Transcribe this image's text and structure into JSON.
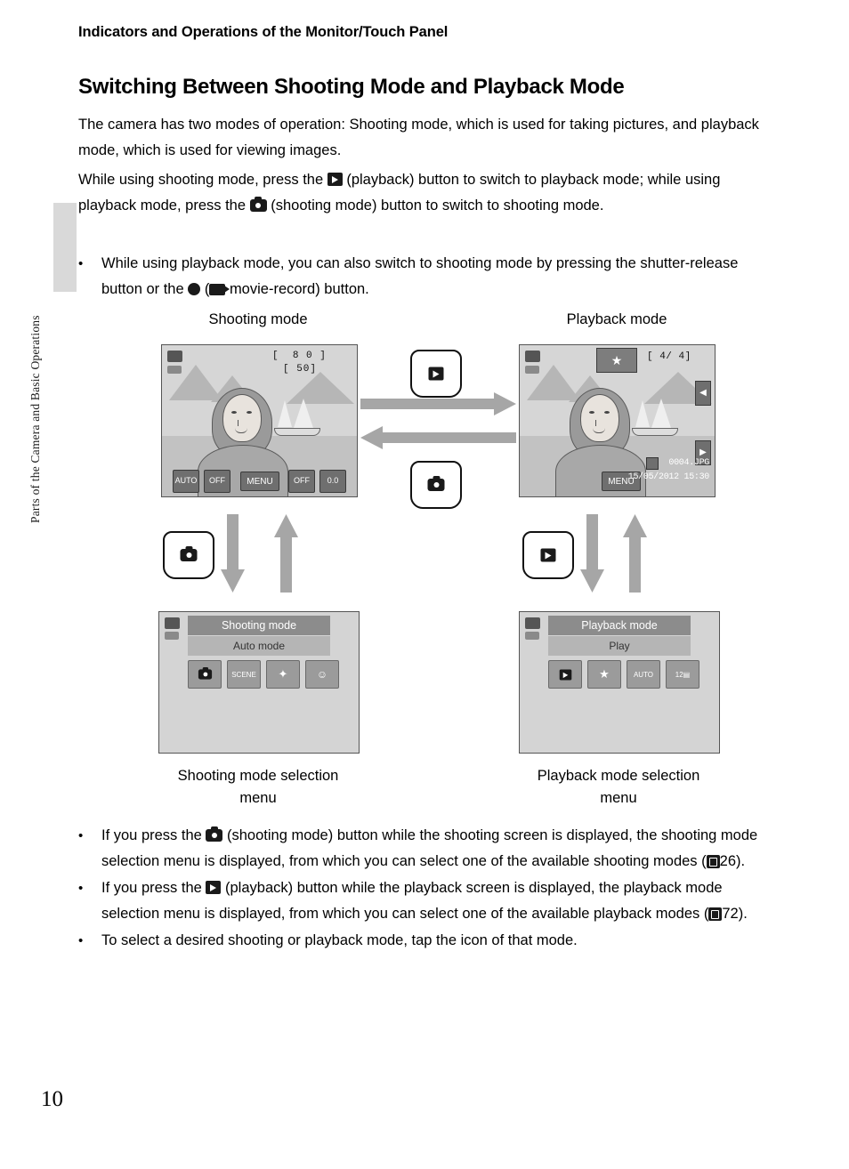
{
  "page": {
    "running_head": "Indicators and Operations of the Monitor/Touch Panel",
    "title": "Switching Between Shooting Mode and Playback Mode",
    "side_tab_text": "Parts of the Camera and Basic Operations",
    "page_number": "10"
  },
  "paragraphs": {
    "p1": "The camera has two modes of operation: Shooting mode, which is used for taking pictures, and playback mode, which is used for viewing images.",
    "p2_a": "While using shooting mode, press the",
    "p2_b": "(playback) button to switch to playback mode; while using playback mode, press the",
    "p2_c": "(shooting mode) button to switch to shooting mode."
  },
  "bullets_top": [
    {
      "a": "While using playback mode, you can also switch to shooting mode by pressing the shutter-release button or the",
      "b": "(",
      "c": "movie-record) button."
    }
  ],
  "bullets_bottom": [
    {
      "a": "If you press the",
      "b": "(shooting mode) button while the shooting screen is displayed, the shooting mode selection menu is displayed, from which you can select one of the available shooting modes (",
      "c": "26)."
    },
    {
      "a": "If you press the",
      "b": "(playback) button while the playback screen is displayed, the playback mode selection menu is displayed, from which you can select one of the available playback modes (",
      "c": "72)."
    },
    {
      "a": "To select a desired shooting or playback mode, tap the icon of that mode.",
      "b": "",
      "c": ""
    }
  ],
  "diagram": {
    "label_shooting_mode": "Shooting mode",
    "label_playback_mode": "Playback mode",
    "caption_shooting_menu": "Shooting mode selection\nmenu",
    "caption_playback_menu": "Playback mode selection\nmenu",
    "shooting_screen": {
      "osd_memory": "8 0",
      "osd_counter": "50",
      "badges": [
        {
          "name": "flash-auto",
          "label": "AUTO"
        },
        {
          "name": "self-timer-off",
          "label": "OFF"
        },
        {
          "name": "menu",
          "label": "MENU"
        },
        {
          "name": "macro-off",
          "label": "OFF"
        },
        {
          "name": "exposure-compensation",
          "label": "0.0"
        }
      ]
    },
    "playback_screen": {
      "frame_counter": "4/ 4",
      "file_name": "0004.JPG",
      "date_time": "15/05/2012 15:30",
      "menu_label": "MENU"
    },
    "shooting_menu": {
      "title": "Shooting mode",
      "selected": "Auto mode",
      "icons": [
        "auto-mode-icon",
        "scene-mode-icon",
        "special-effects-icon",
        "smart-portrait-icon"
      ]
    },
    "playback_menu": {
      "title": "Playback mode",
      "selected": "Play",
      "icons": [
        "play-icon",
        "favorite-pictures-icon",
        "auto-sort-icon",
        "list-by-date-icon"
      ]
    }
  }
}
